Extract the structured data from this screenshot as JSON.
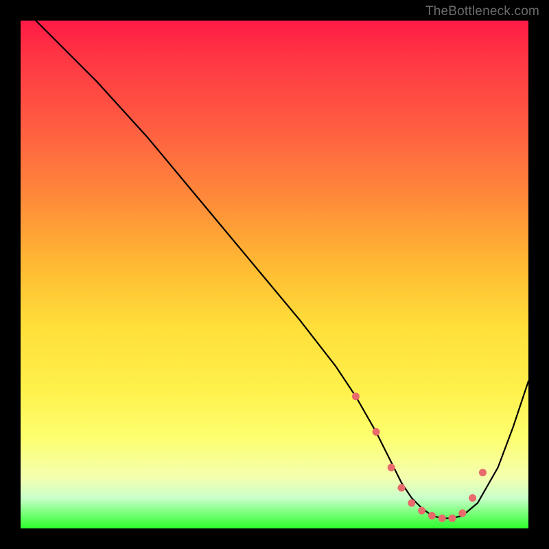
{
  "watermark": "TheBottleneck.com",
  "chart_data": {
    "type": "line",
    "title": "",
    "xlabel": "",
    "ylabel": "",
    "xlim": [
      0,
      100
    ],
    "ylim": [
      0,
      100
    ],
    "series": [
      {
        "name": "bottleneck-curve",
        "x": [
          3,
          8,
          15,
          25,
          35,
          45,
          55,
          62,
          66,
          70,
          73,
          75,
          77,
          79,
          81,
          83,
          85,
          87,
          90,
          94,
          97,
          100
        ],
        "y": [
          100,
          95,
          88,
          77,
          65,
          53,
          41,
          32,
          26,
          19,
          13,
          9,
          6,
          4,
          2.5,
          2,
          2,
          2.5,
          5,
          12,
          20,
          29
        ]
      }
    ],
    "markers": {
      "name": "highlight-dots",
      "color": "#e86a6a",
      "points": [
        {
          "x": 66,
          "y": 26
        },
        {
          "x": 70,
          "y": 19
        },
        {
          "x": 73,
          "y": 12
        },
        {
          "x": 75,
          "y": 8
        },
        {
          "x": 77,
          "y": 5
        },
        {
          "x": 79,
          "y": 3.5
        },
        {
          "x": 81,
          "y": 2.5
        },
        {
          "x": 83,
          "y": 2
        },
        {
          "x": 85,
          "y": 2
        },
        {
          "x": 87,
          "y": 3
        },
        {
          "x": 89,
          "y": 6
        },
        {
          "x": 91,
          "y": 11
        }
      ]
    },
    "gradient_stops": [
      {
        "pos": 0,
        "color": "#ff1a46"
      },
      {
        "pos": 7,
        "color": "#ff3544"
      },
      {
        "pos": 20,
        "color": "#ff5a42"
      },
      {
        "pos": 35,
        "color": "#ff8a3a"
      },
      {
        "pos": 48,
        "color": "#ffb933"
      },
      {
        "pos": 60,
        "color": "#ffde3a"
      },
      {
        "pos": 72,
        "color": "#fff04a"
      },
      {
        "pos": 82,
        "color": "#fdff6e"
      },
      {
        "pos": 90,
        "color": "#f4ffb0"
      },
      {
        "pos": 94,
        "color": "#c9ffca"
      },
      {
        "pos": 100,
        "color": "#2bff2b"
      }
    ]
  }
}
